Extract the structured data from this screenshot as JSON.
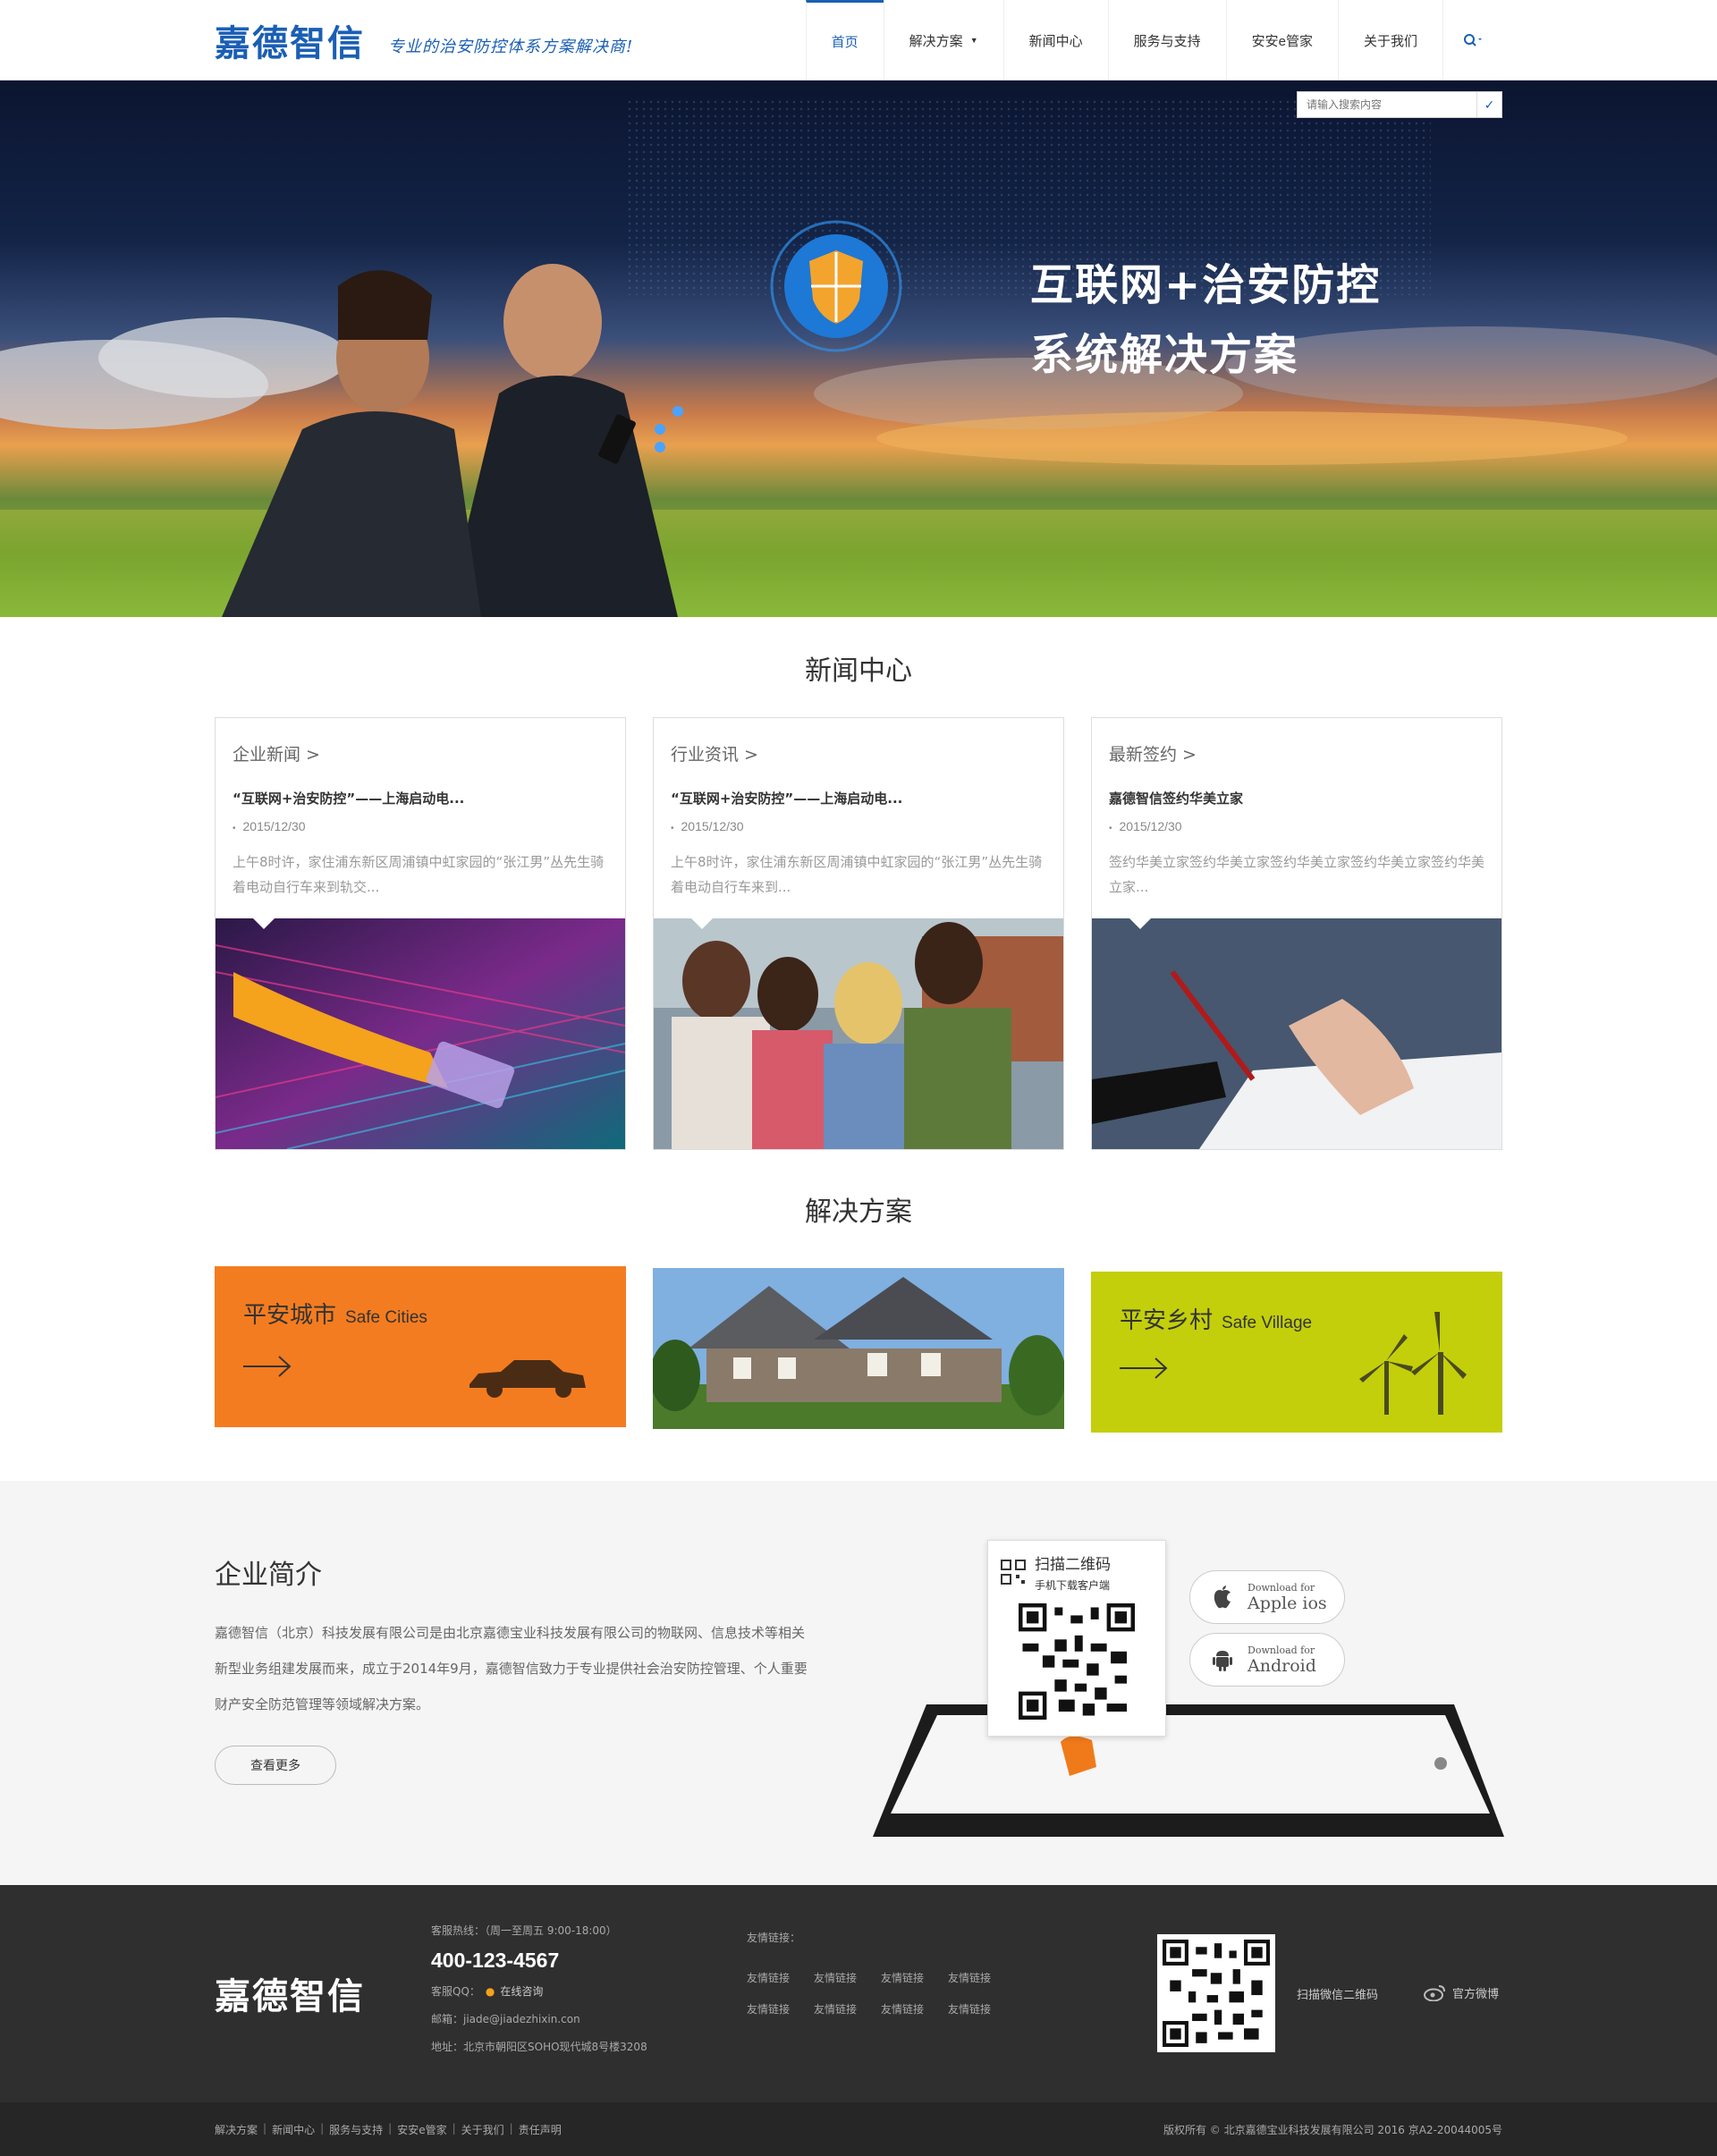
{
  "header": {
    "logo": "嘉德智信",
    "slogan": "专业的治安防控体系方案解决商!",
    "nav": [
      {
        "label": "首页"
      },
      {
        "label": "解决方案"
      },
      {
        "label": "新闻中心"
      },
      {
        "label": "服务与支持"
      },
      {
        "label": "安安e管家"
      },
      {
        "label": "关于我们"
      }
    ]
  },
  "banner": {
    "search_placeholder": "请输入搜索内容",
    "title_line1": "互联网+治安防控",
    "title_line2": "系统解决方案"
  },
  "news": {
    "title": "新闻中心",
    "cards": [
      {
        "category": "企业新闻 >",
        "headline": "“互联网+治安防控”——上海启动电...",
        "date": "2015/12/30",
        "body": "上午8时许，家住浦东新区周浦镇中虹家园的“张江男”丛先生骑着电动自行车来到轨交..."
      },
      {
        "category": "行业资讯 >",
        "headline": "“互联网+治安防控”——上海启动电...",
        "date": "2015/12/30",
        "body": "上午8时许，家住浦东新区周浦镇中虹家园的“张江男”丛先生骑着电动自行车来到..."
      },
      {
        "category": "最新签约 >",
        "headline": "嘉德智信签约华美立家",
        "date": "2015/12/30",
        "body": "签约华美立家签约华美立家签约华美立家签约华美立家签约华美立家..."
      }
    ]
  },
  "solutions": {
    "title": "解决方案",
    "items": [
      {
        "cn": "平安城市",
        "en": "Safe Cities",
        "color": "#f47c20"
      },
      {
        "cn": "平安乡村",
        "en": "Safe Village",
        "color": "#c3cf0a"
      }
    ]
  },
  "intro": {
    "title": "企业简介",
    "text": "嘉德智信（北京）科技发展有限公司是由北京嘉德宝业科技发展有限公司的物联网、信息技术等相关新型业务组建发展而来，成立于2014年9月，嘉德智信致力于专业提供社会治安防控管理、个人重要财产安全防范管理等领域解决方案。",
    "more": "查看更多",
    "qr_title": "扫描二维码",
    "qr_sub": "手机下载客户端",
    "ios_small": "Download for",
    "ios_big": "Apple ios",
    "android_small": "Download for",
    "android_big": "Android"
  },
  "footer": {
    "logo": "嘉德智信",
    "hotline_label": "客服热线：（周一至周五 9:00-18:00）",
    "phone": "400-123-4567",
    "qq_label": "客服QQ：",
    "qq_link": "在线咨询",
    "email": "邮箱：jiade@jiadezhixin.con",
    "address": "地址：北京市朝阳区SOHO现代城8号楼3208",
    "links_title": "友情链接：",
    "links": [
      "友情链接",
      "友情链接",
      "友情链接",
      "友情链接",
      "友情链接",
      "友情链接",
      "友情链接",
      "友情链接"
    ],
    "scan_text": "扫描微信二维码",
    "weibo": "官方微博",
    "bottom_links": [
      "解决方案",
      "新闻中心",
      "服务与支持",
      "安安e管家",
      "关于我们",
      "责任声明"
    ],
    "copyright": "版权所有 © 北京嘉德宝业科技发展有限公司 2016 京A2-20044005号"
  },
  "colors": {
    "brand": "#1a5fb4",
    "orange": "#f47c20",
    "lime": "#c3cf0a"
  }
}
